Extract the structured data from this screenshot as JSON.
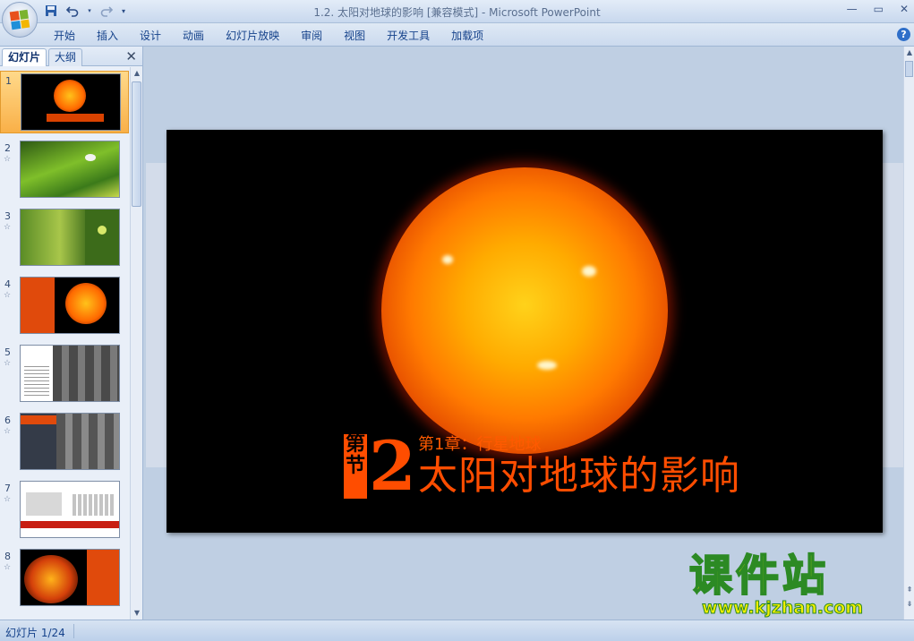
{
  "window": {
    "title": "1.2. 太阳对地球的影响 [兼容模式] - Microsoft PowerPoint",
    "controls": [
      "—",
      "▭",
      "✕"
    ]
  },
  "quick_access": {
    "save_icon": "save-icon",
    "undo_icon": "undo-icon",
    "redo_icon": "redo-icon",
    "more_icon": "customize-icon"
  },
  "ribbon": {
    "tabs": [
      "开始",
      "插入",
      "设计",
      "动画",
      "幻灯片放映",
      "审阅",
      "视图",
      "开发工具",
      "加载项"
    ],
    "help": "?"
  },
  "pane": {
    "tab_slides": "幻灯片",
    "tab_outline": "大纲",
    "close": "✕",
    "slides": [
      {
        "num": "1",
        "star": ""
      },
      {
        "num": "2",
        "star": "☆"
      },
      {
        "num": "3",
        "star": "☆"
      },
      {
        "num": "4",
        "star": "☆"
      },
      {
        "num": "5",
        "star": "☆"
      },
      {
        "num": "6",
        "star": "☆"
      },
      {
        "num": "7",
        "star": "☆"
      },
      {
        "num": "8",
        "star": "☆"
      }
    ],
    "selected": 1
  },
  "slide": {
    "chapter_chars": "第节",
    "chapter_num": "2",
    "subtitle": "第1章：行星地球",
    "title": "太阳对地球的影响"
  },
  "watermark": {
    "name": "课件站",
    "url": "www.kjzhan.com"
  },
  "status": {
    "slide_indicator": "幻灯片 1/24"
  },
  "colors": {
    "accent_orange": "#ff4d00",
    "ribbon_text": "#15428b",
    "selected_thumb": "#f9b048"
  }
}
